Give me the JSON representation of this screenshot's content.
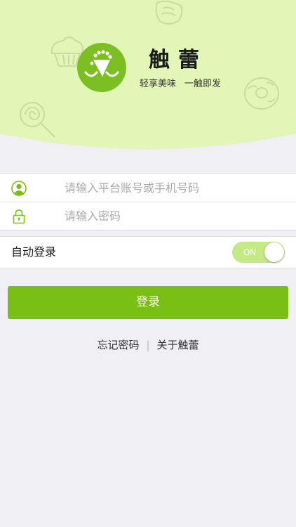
{
  "colors": {
    "header_bg": "#e2f6b8",
    "page_bg": "#efeff4",
    "accent": "#7abf13",
    "toggle_on": "#c4ea86"
  },
  "brand": {
    "name": "触蕾",
    "slogan_left": "轻享美味",
    "slogan_right": "一触即发",
    "logo_icon": "crown-face-logo"
  },
  "login": {
    "account_placeholder": "请输入平台账号或手机号码",
    "account_value": "",
    "account_icon": "user-icon",
    "password_placeholder": "请输入密码",
    "password_value": "",
    "password_icon": "lock-icon"
  },
  "auto_login": {
    "label": "自动登录",
    "toggle_text": "ON",
    "enabled": true
  },
  "login_button": "登录",
  "links": {
    "forgot_password": "忘记密码",
    "separator": "|",
    "about": "关于触蕾"
  }
}
